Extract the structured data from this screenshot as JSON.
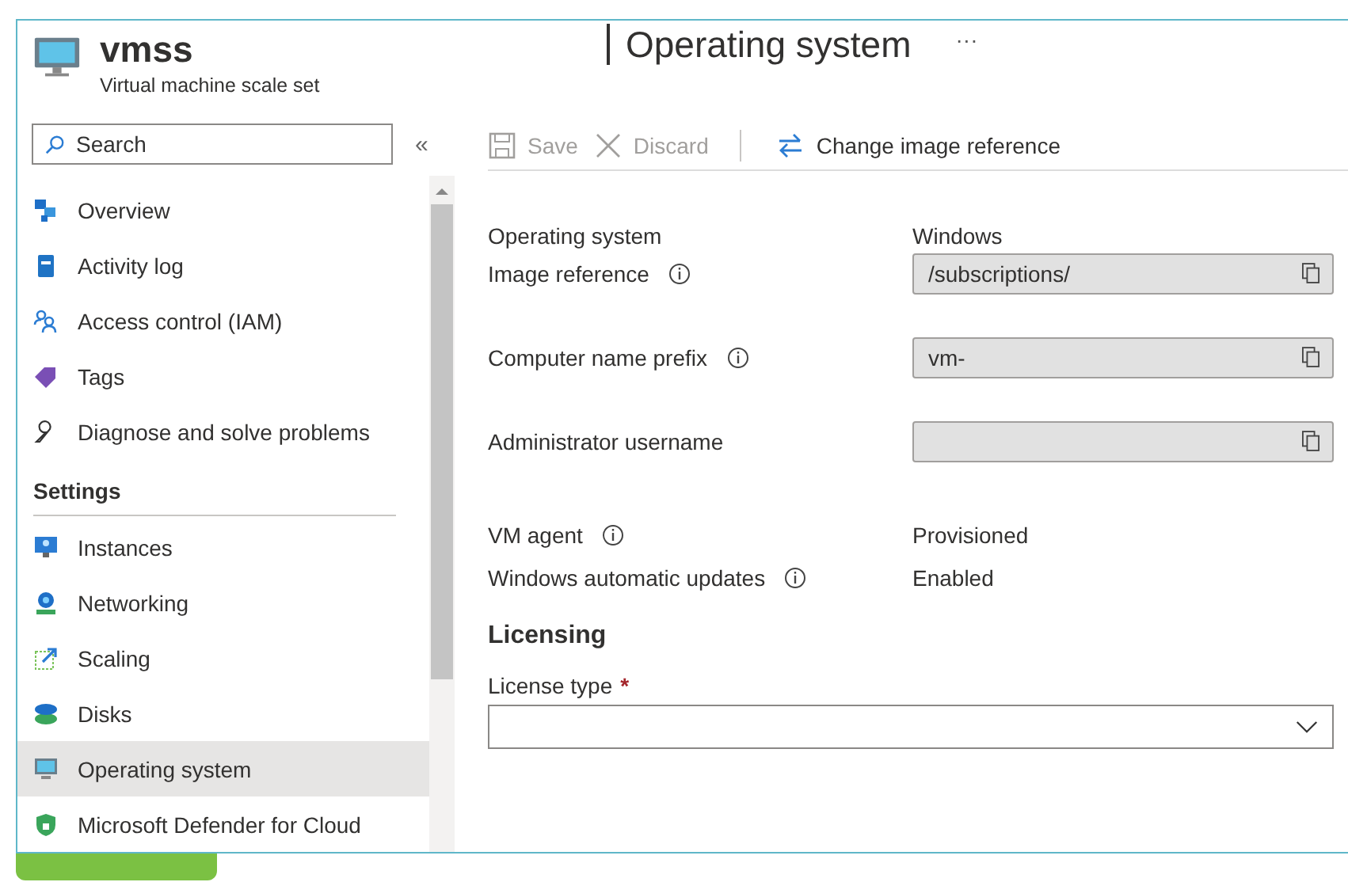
{
  "header": {
    "title": "vmss",
    "subtitle": "Virtual machine scale set"
  },
  "blade": {
    "title": "Operating system",
    "more": "···"
  },
  "sidebar": {
    "search": {
      "placeholder": "Search"
    },
    "collapse": "«",
    "items": [
      {
        "kind": "item",
        "label": "Overview",
        "selected": false
      },
      {
        "kind": "item",
        "label": "Activity log",
        "selected": false
      },
      {
        "kind": "item",
        "label": "Access control (IAM)",
        "selected": false
      },
      {
        "kind": "item",
        "label": "Tags",
        "selected": false
      },
      {
        "kind": "item",
        "label": "Diagnose and solve problems",
        "selected": false
      },
      {
        "kind": "heading",
        "label": "Settings"
      },
      {
        "kind": "item",
        "label": "Instances",
        "selected": false
      },
      {
        "kind": "item",
        "label": "Networking",
        "selected": false
      },
      {
        "kind": "item",
        "label": "Scaling",
        "selected": false
      },
      {
        "kind": "item",
        "label": "Disks",
        "selected": false
      },
      {
        "kind": "item",
        "label": "Operating system",
        "selected": true
      },
      {
        "kind": "item",
        "label": "Microsoft Defender for Cloud",
        "selected": false
      }
    ]
  },
  "toolbar": [
    {
      "kind": "save",
      "label": "Save",
      "disabled": true
    },
    {
      "kind": "discard",
      "label": "Discard",
      "disabled": true
    },
    {
      "kind": "swap",
      "label": "Change image reference",
      "disabled": false
    }
  ],
  "form": [
    {
      "kind": "text",
      "label": "Operating system",
      "info": false,
      "value": "Windows"
    },
    {
      "kind": "field",
      "label": "Image reference",
      "info": true,
      "value": "/subscriptions/"
    },
    {
      "kind": "field",
      "label": "Computer name prefix",
      "info": true,
      "value": "vm-"
    },
    {
      "kind": "field",
      "label": "Administrator username",
      "info": false
    },
    {
      "kind": "text",
      "label": "VM agent",
      "info": true,
      "value": "Provisioned"
    },
    {
      "kind": "text",
      "label": "Windows automatic updates",
      "info": true,
      "value": "Enabled"
    }
  ],
  "licensing": {
    "title": "Licensing",
    "label": "License type",
    "required": true,
    "required_mark": "*"
  }
}
